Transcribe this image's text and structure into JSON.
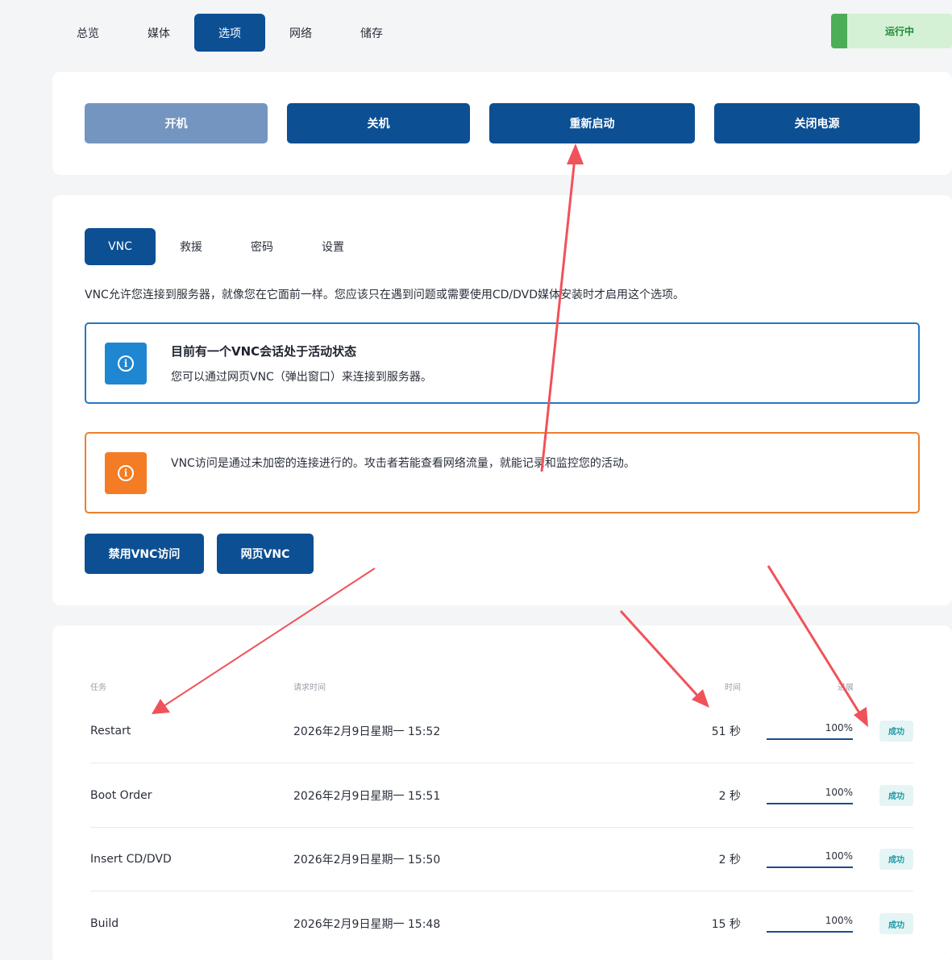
{
  "nav": {
    "tabs": [
      {
        "label": "总览",
        "active": false
      },
      {
        "label": "媒体",
        "active": false
      },
      {
        "label": "选项",
        "active": true
      },
      {
        "label": "网络",
        "active": false
      },
      {
        "label": "储存",
        "active": false
      }
    ],
    "status": {
      "label": "运行中",
      "color": "#4cae56"
    }
  },
  "power": {
    "power_on": "开机",
    "shutdown": "关机",
    "restart": "重新启动",
    "power_off": "关闭电源"
  },
  "vnc": {
    "tabs": [
      {
        "label": "VNC",
        "active": true
      },
      {
        "label": "救援",
        "active": false
      },
      {
        "label": "密码",
        "active": false
      },
      {
        "label": "设置",
        "active": false
      }
    ],
    "description": "VNC允许您连接到服务器，就像您在它面前一样。您应该只在遇到问题或需要使用CD/DVD媒体安装时才启用这个选项。",
    "info_alert": {
      "title": "目前有一个VNC会话处于活动状态",
      "body": "您可以通过网页VNC（弹出窗口）来连接到服务器。"
    },
    "warn_alert": {
      "body": "VNC访问是通过未加密的连接进行的。攻击者若能查看网络流量，就能记录和监控您的活动。"
    },
    "disable_button": "禁用VNC访问",
    "web_vnc_button": "网页VNC"
  },
  "tasks": {
    "headers": {
      "task": "任务",
      "requested": "请求时间",
      "duration": "时间",
      "progress": "进展"
    },
    "rows": [
      {
        "task": "Restart",
        "requested": "2026年2月9日星期一 15:52",
        "duration": "51 秒",
        "progress": "100%",
        "progress_value": 1.0,
        "status": "成功"
      },
      {
        "task": "Boot Order",
        "requested": "2026年2月9日星期一 15:51",
        "duration": "2 秒",
        "progress": "100%",
        "progress_value": 1.0,
        "status": "成功"
      },
      {
        "task": "Insert CD/DVD",
        "requested": "2026年2月9日星期一 15:50",
        "duration": "2 秒",
        "progress": "100%",
        "progress_value": 1.0,
        "status": "成功"
      },
      {
        "task": "Build",
        "requested": "2026年2月9日星期一 15:48",
        "duration": "15 秒",
        "progress": "100%",
        "progress_value": 1.0,
        "status": "成功"
      }
    ]
  },
  "colors": {
    "primary": "#0c4f93",
    "annotation_arrow": "#f0525a",
    "success": "#1b9aa6"
  }
}
